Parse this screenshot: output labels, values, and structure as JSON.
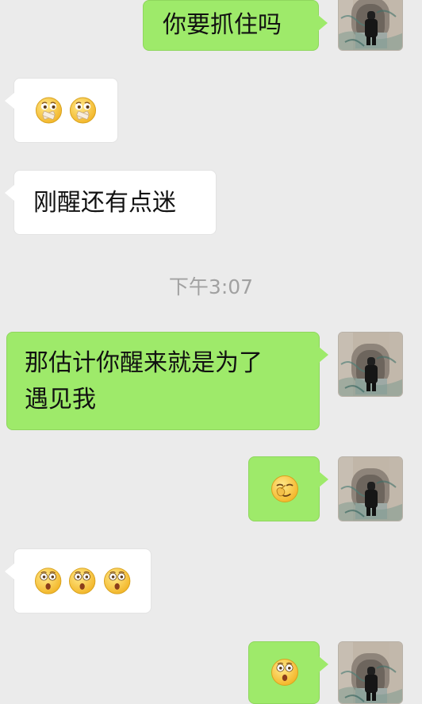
{
  "conversation": {
    "messages": [
      {
        "direction": "sent",
        "text": "你要抓住吗"
      },
      {
        "direction": "received",
        "emoji": [
          "mouth-zip-face-emoji",
          "mouth-zip-face-emoji"
        ]
      },
      {
        "direction": "received",
        "text": "刚醒还有点迷"
      },
      {
        "direction": "sent",
        "text_line1": "那估计你醒来就是为了",
        "text_line2": "遇见我"
      },
      {
        "direction": "sent",
        "emoji": [
          "thinking-hand-emoji"
        ]
      },
      {
        "direction": "received",
        "emoji": [
          "surprised-face-emoji",
          "surprised-face-emoji",
          "surprised-face-emoji"
        ]
      },
      {
        "direction": "sent",
        "emoji": [
          "surprised-face-emoji"
        ]
      }
    ],
    "timestamp": "下午3:07"
  },
  "colors": {
    "background": "#ebebeb",
    "sent_bubble": "#9eea6a",
    "received_bubble": "#ffffff",
    "timestamp_text": "#a1a1a1"
  },
  "icons": {
    "avatar": "user-avatar-photo",
    "emoji_mouth_zip": "mouth-zip-face-emoji",
    "emoji_surprised": "surprised-face-emoji",
    "emoji_thinking": "thinking-hand-emoji"
  }
}
